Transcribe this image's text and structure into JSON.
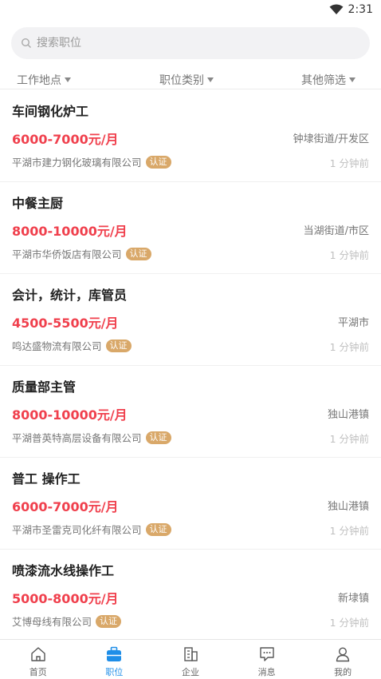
{
  "status_bar": {
    "time": "2:31"
  },
  "search": {
    "placeholder": "搜索职位",
    "value": ""
  },
  "filters": [
    {
      "label": "工作地点"
    },
    {
      "label": "职位类别"
    },
    {
      "label": "其他筛选"
    }
  ],
  "jobs": [
    {
      "title": "车间钢化炉工",
      "salary": "6000-7000元/月",
      "location": "钟埭街道/开发区",
      "company": "平湖市建力钢化玻璃有限公司",
      "badge": "认证",
      "time": "1 分钟前"
    },
    {
      "title": "中餐主厨",
      "salary": "8000-10000元/月",
      "location": "当湖街道/市区",
      "company": "平湖市华侨饭店有限公司",
      "badge": "认证",
      "time": "1 分钟前"
    },
    {
      "title": "会计，统计，库管员",
      "salary": "4500-5500元/月",
      "location": "平湖市",
      "company": "鸣达盛物流有限公司",
      "badge": "认证",
      "time": "1 分钟前"
    },
    {
      "title": "质量部主管",
      "salary": "8000-10000元/月",
      "location": "独山港镇",
      "company": "平湖普英特高层设备有限公司",
      "badge": "认证",
      "time": "1 分钟前"
    },
    {
      "title": "普工  操作工",
      "salary": "6000-7000元/月",
      "location": "独山港镇",
      "company": "平湖市圣雷克司化纤有限公司",
      "badge": "认证",
      "time": "1 分钟前"
    },
    {
      "title": "喷漆流水线操作工",
      "salary": "5000-8000元/月",
      "location": "新埭镇",
      "company": "艾博母线有限公司",
      "badge": "认证",
      "time": "1 分钟前"
    }
  ],
  "tabs": [
    {
      "label": "首页",
      "icon": "home-icon"
    },
    {
      "label": "职位",
      "icon": "briefcase-icon"
    },
    {
      "label": "企业",
      "icon": "building-icon"
    },
    {
      "label": "消息",
      "icon": "message-icon"
    },
    {
      "label": "我的",
      "icon": "user-icon"
    }
  ],
  "colors": {
    "accent": "#1e8ee8",
    "salary": "#f0404d",
    "badge": "#d9a869"
  }
}
